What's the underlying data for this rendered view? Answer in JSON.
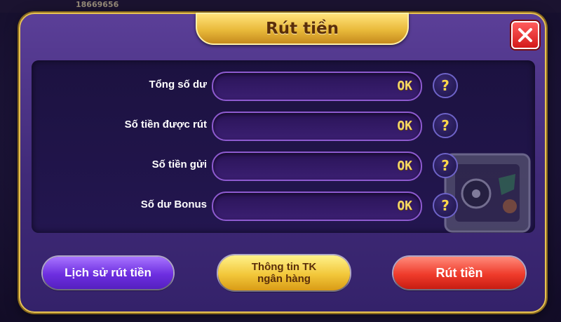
{
  "background": {
    "counter_text": "18669656"
  },
  "dialog": {
    "title": "Rút tiền",
    "close_icon": "close-x-icon"
  },
  "rows": [
    {
      "label": "Tổng số dư",
      "value": "OK",
      "help_icon": "?"
    },
    {
      "label": "Số tiền được rút",
      "value": "OK",
      "help_icon": "?"
    },
    {
      "label": "Số tiền gửi",
      "value": "OK",
      "help_icon": "?"
    },
    {
      "label": "Số dư Bonus",
      "value": "OK",
      "help_icon": "?"
    }
  ],
  "buttons": {
    "history": "Lịch sử rút tiền",
    "bank_info_line1": "Thông tin TK",
    "bank_info_line2": "ngân hàng",
    "withdraw": "Rút tiền"
  },
  "colors": {
    "dialog_bg": "#402a78",
    "gold": "#e9b93a",
    "value_text": "#f6d766",
    "close_red": "#d41a1a",
    "history_purple": "#6d2ee0",
    "withdraw_red": "#ef3b2b"
  }
}
